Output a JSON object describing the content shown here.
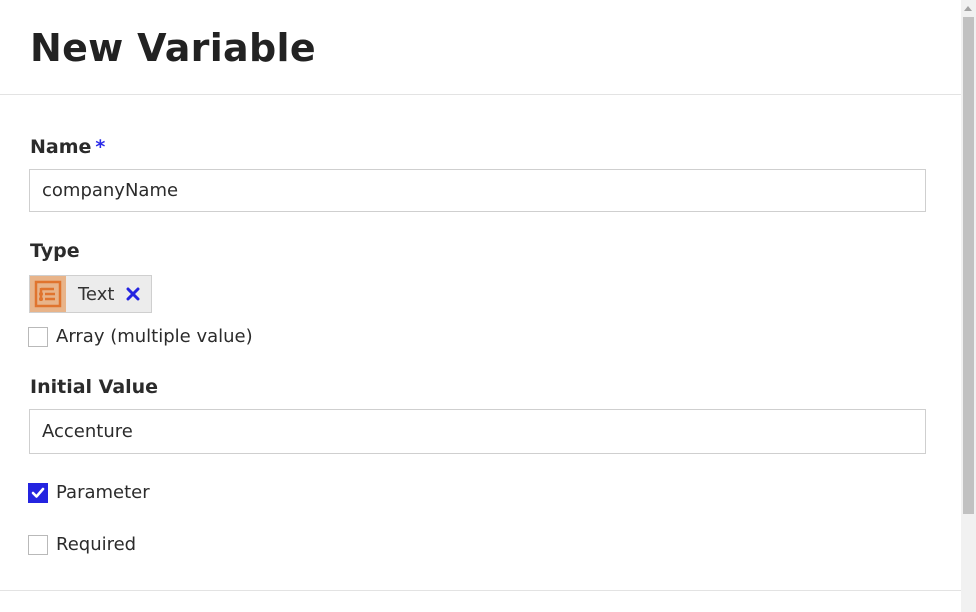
{
  "header": {
    "title": "New Variable"
  },
  "form": {
    "name": {
      "label": "Name",
      "required_mark": "*",
      "value": "companyName"
    },
    "type": {
      "label": "Type",
      "chip_label": "Text",
      "chip_icon": "text-type-icon",
      "remove_icon": "close-icon"
    },
    "array": {
      "label": "Array (multiple value)",
      "checked": false
    },
    "initial_value": {
      "label": "Initial Value",
      "value": "Accenture"
    },
    "parameter": {
      "label": "Parameter",
      "checked": true
    },
    "required": {
      "label": "Required",
      "checked": false
    }
  },
  "colors": {
    "accent": "#2424e0",
    "type_icon_bg": "#e8b48a",
    "type_icon_fg": "#e0742e"
  }
}
